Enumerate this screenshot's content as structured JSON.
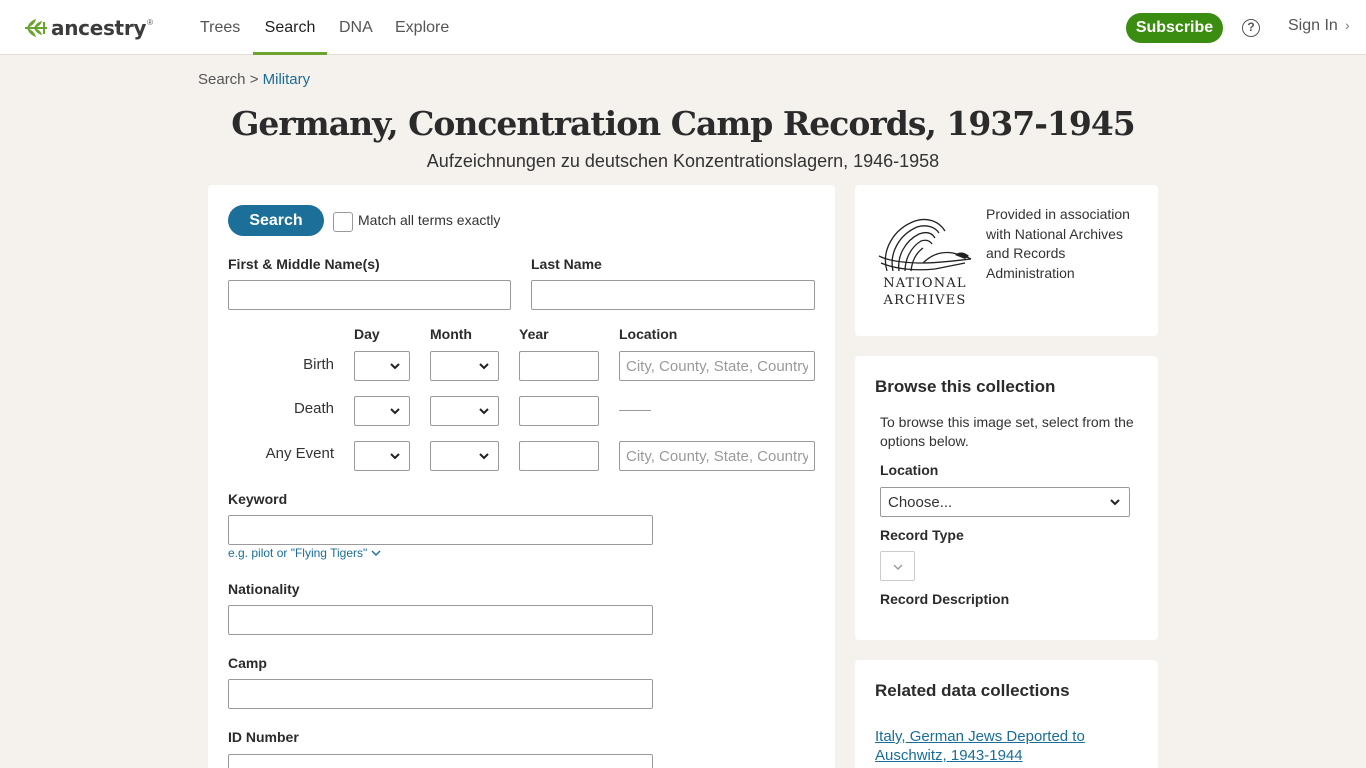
{
  "header": {
    "logo_text": "ancestry",
    "logo_tm": "®",
    "nav": [
      {
        "label": "Trees"
      },
      {
        "label": "Search"
      },
      {
        "label": "DNA"
      },
      {
        "label": "Explore"
      }
    ],
    "subscribe_label": "Subscribe",
    "help_symbol": "?",
    "signin_label": "Sign In",
    "signin_chevron": "›",
    "accent_color": "#6aa42c",
    "subscribe_color": "#3b8d11"
  },
  "breadcrumb": {
    "root": "Search",
    "separator": ">",
    "current": "Military"
  },
  "page": {
    "title": "Germany, Concentration Camp Records, 1937-1945",
    "subtitle": "Aufzeichnungen zu deutschen Konzentrationslagern, 1946-1958"
  },
  "form": {
    "search_label": "Search",
    "match_exact_label": "Match all terms exactly",
    "first_name_label": "First & Middle Name(s)",
    "last_name_label": "Last Name",
    "col_day": "Day",
    "col_month": "Month",
    "col_year": "Year",
    "col_location": "Location",
    "row_birth": "Birth",
    "row_death": "Death",
    "row_any": "Any Event",
    "location_placeholder": "City, County, State, Country",
    "keyword_label": "Keyword",
    "keyword_hint": "e.g. pilot or \"Flying Tigers\"",
    "nationality_label": "Nationality",
    "camp_label": "Camp",
    "id_label": "ID Number",
    "button_color": "#1b6f98"
  },
  "info": {
    "logo_line1": "NATIONAL",
    "logo_line2": "ARCHIVES",
    "text": "Provided in association with National Archives and Records Administration"
  },
  "browse": {
    "title": "Browse this collection",
    "description": "To browse this image set, select from the options below.",
    "location_label": "Location",
    "location_value": "Choose...",
    "record_type_label": "Record Type",
    "record_description_label": "Record Description"
  },
  "related": {
    "title": "Related data collections",
    "link": "Italy, German Jews Deported to Auschwitz, 1943-1944"
  }
}
